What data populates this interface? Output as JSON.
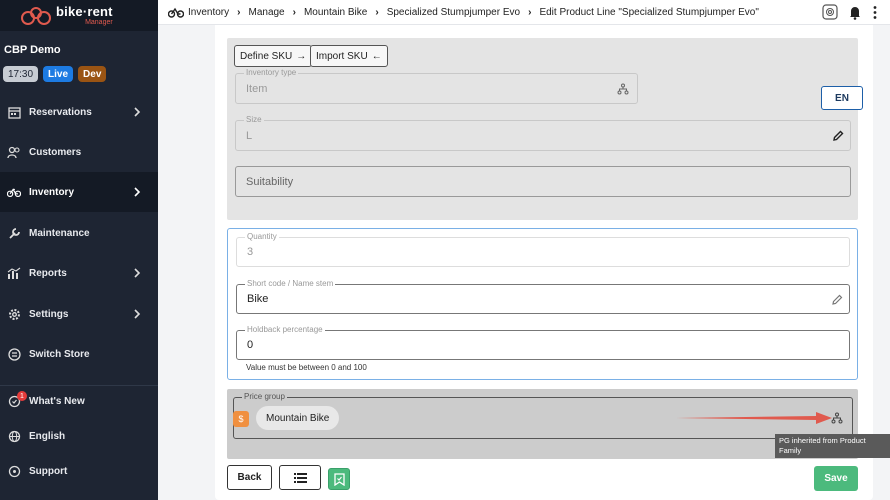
{
  "app": {
    "logo_text": "bike·rent",
    "logo_sub": "Manager",
    "store_name": "CBP Demo",
    "time": "17:30",
    "env_live": "Live",
    "env_dev": "Dev"
  },
  "sidebar": {
    "items": [
      {
        "label": "Reservations",
        "icon": "calendar-icon",
        "chevron": true
      },
      {
        "label": "Customers",
        "icon": "users-icon",
        "chevron": false
      },
      {
        "label": "Inventory",
        "icon": "bike-icon",
        "chevron": true,
        "active": true
      },
      {
        "label": "Maintenance",
        "icon": "wrench-icon",
        "chevron": false
      },
      {
        "label": "Reports",
        "icon": "chart-icon",
        "chevron": true
      },
      {
        "label": "Settings",
        "icon": "gear-icon",
        "chevron": true
      },
      {
        "label": "Switch Store",
        "icon": "switch-icon",
        "chevron": false
      }
    ],
    "bottom": [
      {
        "label": "What's New",
        "icon": "sparkle-icon",
        "notification_count": "1"
      },
      {
        "label": "English",
        "icon": "globe-icon"
      },
      {
        "label": "Support",
        "icon": "help-icon"
      }
    ]
  },
  "breadcrumb": [
    "Inventory",
    "Manage",
    "Mountain Bike",
    "Specialized Stumpjumper Evo",
    "Edit Product Line \"Specialized Stumpjumper Evo\""
  ],
  "form": {
    "define_sku": "Define SKU",
    "import_sku": "Import SKU",
    "language": "EN",
    "inventory_type": {
      "label": "Inventory type",
      "value": "Item"
    },
    "size": {
      "label": "Size",
      "value": "L"
    },
    "suitability": {
      "placeholder": "Suitability"
    },
    "quantity": {
      "label": "Quantity",
      "value": "3"
    },
    "short_code": {
      "label": "Short code / Name stem",
      "value": "Bike"
    },
    "holdback": {
      "label": "Holdback percentage",
      "value": "0",
      "helper": "Value must be between 0 and 100"
    },
    "price_group": {
      "label": "Price group",
      "value": "Mountain Bike",
      "tooltip": "PG inherited from Product Family"
    }
  },
  "actions": {
    "back": "Back",
    "save": "Save"
  },
  "colors": {
    "sidebar_bg": "#1e2533",
    "accent_blue": "#1d7be2",
    "save_green": "#4cba7d",
    "arrow_red": "#e05a4e"
  }
}
